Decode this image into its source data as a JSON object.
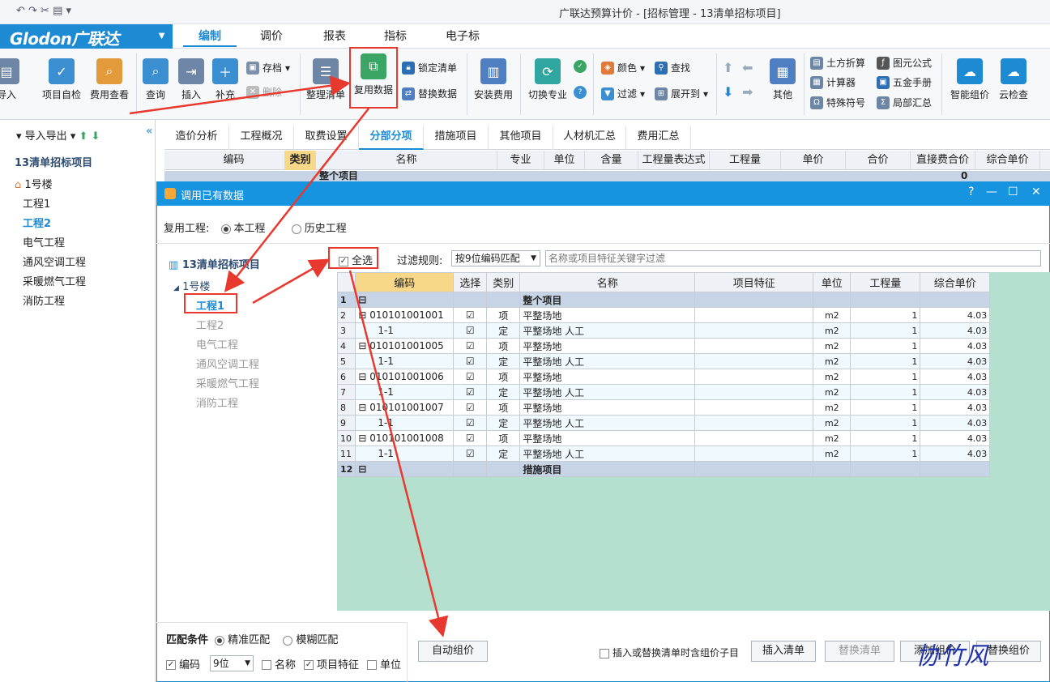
{
  "window": {
    "title": "广联达预算计价 - [招标管理 - 13清单招标项目]",
    "quick_access": "↶ ↷ ✂ ▤ ▾"
  },
  "logo": {
    "brand": "Glodon广联达"
  },
  "menu_tabs": [
    "编制",
    "调价",
    "报表",
    "指标",
    "电子标"
  ],
  "ribbon": {
    "import": "导入",
    "self_check": "项目自检",
    "fee_view": "费用查看",
    "query": "查询",
    "insert": "插入",
    "supplement": "补充",
    "archive": "存档",
    "delete": "删除",
    "organize_list": "整理清单",
    "reuse_data": "复用数据",
    "lock_list": "锁定清单",
    "replace_data": "替换数据",
    "install_fee": "安装费用",
    "switch_major": "切换专业",
    "color": "颜色",
    "find": "查找",
    "filter": "过滤",
    "expand_to": "展开到",
    "other": "其他",
    "earthwork": "土方折算",
    "element_formula": "图元公式",
    "calculator": "计算器",
    "hardware_manual": "五金手册",
    "special_symbol": "特殊符号",
    "local_summary": "局部汇总",
    "smart_pricing": "智能组价",
    "cloud_check": "云检查"
  },
  "left_panel": {
    "toolbar": "导入导出",
    "project": "13清单招标项目",
    "building": "1号楼",
    "items": [
      "工程1",
      "工程2",
      "电气工程",
      "通风空调工程",
      "采暖燃气工程",
      "消防工程"
    ],
    "active_index": 1
  },
  "page_tabs": [
    "造价分析",
    "工程概况",
    "取费设置",
    "分部分项",
    "措施项目",
    "其他项目",
    "人材机汇总",
    "费用汇总"
  ],
  "active_page_tab": "分部分项",
  "main_headers": [
    "编码",
    "类别",
    "名称",
    "专业",
    "单位",
    "含量",
    "工程量表达式",
    "工程量",
    "单价",
    "合价",
    "直接费合价",
    "综合单价"
  ],
  "main_first_row": {
    "name": "整个项目",
    "value": "0"
  },
  "dialog": {
    "title": "调用已有数据",
    "controls": [
      "?",
      "—",
      "☐",
      "✕"
    ],
    "reuse_label": "复用工程:",
    "reuse_options": [
      "本工程",
      "历史工程"
    ],
    "tree_project": "13清单招标项目",
    "tree_building": "1号楼",
    "tree_items": [
      "工程1",
      "工程2",
      "电气工程",
      "通风空调工程",
      "采暖燃气工程",
      "消防工程"
    ],
    "select_all": "全选",
    "filter_label": "过滤规则:",
    "filter_value": "按9位编码匹配",
    "filter_placeholder": "名称或项目特征关键字过滤",
    "grid_headers": [
      "编码",
      "选择",
      "类别",
      "名称",
      "项目特征",
      "单位",
      "工程量",
      "综合单价"
    ],
    "rows": [
      {
        "n": "1",
        "code": "",
        "sel": "",
        "type": "",
        "name": "整个项目",
        "feature": "",
        "unit": "",
        "qty": "",
        "price": "",
        "grp": true
      },
      {
        "n": "2",
        "code": "010101001001",
        "sel": "☑",
        "type": "项",
        "name": "平整场地",
        "feature": "",
        "unit": "m2",
        "qty": "1",
        "price": "4.03"
      },
      {
        "n": "3",
        "code": "1-1",
        "sel": "☑",
        "type": "定",
        "name": "平整场地 人工",
        "feature": "",
        "unit": "m2",
        "qty": "1",
        "price": "4.03"
      },
      {
        "n": "4",
        "code": "010101001005",
        "sel": "☑",
        "type": "项",
        "name": "平整场地",
        "feature": "",
        "unit": "m2",
        "qty": "1",
        "price": "4.03"
      },
      {
        "n": "5",
        "code": "1-1",
        "sel": "☑",
        "type": "定",
        "name": "平整场地 人工",
        "feature": "",
        "unit": "m2",
        "qty": "1",
        "price": "4.03"
      },
      {
        "n": "6",
        "code": "010101001006",
        "sel": "☑",
        "type": "项",
        "name": "平整场地",
        "feature": "",
        "unit": "m2",
        "qty": "1",
        "price": "4.03"
      },
      {
        "n": "7",
        "code": "1-1",
        "sel": "☑",
        "type": "定",
        "name": "平整场地 人工",
        "feature": "",
        "unit": "m2",
        "qty": "1",
        "price": "4.03"
      },
      {
        "n": "8",
        "code": "010101001007",
        "sel": "☑",
        "type": "项",
        "name": "平整场地",
        "feature": "",
        "unit": "m2",
        "qty": "1",
        "price": "4.03"
      },
      {
        "n": "9",
        "code": "1-1",
        "sel": "☑",
        "type": "定",
        "name": "平整场地 人工",
        "feature": "",
        "unit": "m2",
        "qty": "1",
        "price": "4.03"
      },
      {
        "n": "10",
        "code": "010101001008",
        "sel": "☑",
        "type": "项",
        "name": "平整场地",
        "feature": "",
        "unit": "m2",
        "qty": "1",
        "price": "4.03"
      },
      {
        "n": "11",
        "code": "1-1",
        "sel": "☑",
        "type": "定",
        "name": "平整场地 人工",
        "feature": "",
        "unit": "m2",
        "qty": "1",
        "price": "4.03"
      },
      {
        "n": "12",
        "code": "",
        "sel": "",
        "type": "",
        "name": "措施项目",
        "feature": "",
        "unit": "",
        "qty": "",
        "price": "",
        "grp": true
      }
    ],
    "match_label": "匹配条件",
    "match_options": [
      "精准匹配",
      "模糊匹配"
    ],
    "code_label": "编码",
    "code_digits": "9位",
    "name_label": "名称",
    "feature_label": "项目特征",
    "unit_label": "单位",
    "auto_pricing": "自动组价",
    "insert_sub_note": "插入或替换清单时含组价子目",
    "insert_list": "插入清单",
    "replace_list": "替换清单",
    "add_pricing": "添加组价",
    "replace_pricing": "替换组价"
  },
  "watermark": "协竹风",
  "colors": {
    "accent": "#1d8bd4",
    "annotation": "#e8392f",
    "grid_bg": "#b5dfcf"
  }
}
